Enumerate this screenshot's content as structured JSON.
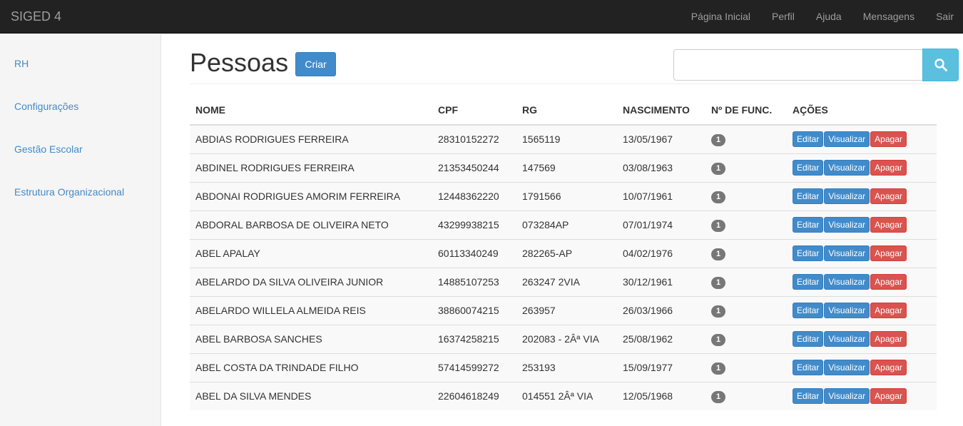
{
  "app": {
    "brand": "SIGED 4",
    "nav": [
      "Página Inicial",
      "Perfil",
      "Ajuda",
      "Mensagens",
      "Sair"
    ]
  },
  "sidebar": {
    "items": [
      "RH",
      "Configurações",
      "Gestão Escolar",
      "Estrutura Organizacional"
    ]
  },
  "page": {
    "title": "Pessoas",
    "create_label": "Criar",
    "search_value": ""
  },
  "table": {
    "headers": [
      "NOME",
      "CPF",
      "RG",
      "NASCIMENTO",
      "Nº DE FUNC.",
      "AÇÕES"
    ],
    "actions": {
      "edit": "Editar",
      "view": "Visualizar",
      "delete": "Apagar"
    },
    "rows": [
      {
        "nome": "ABDIAS RODRIGUES FERREIRA",
        "cpf": "28310152272",
        "rg": "1565119",
        "nascimento": "13/05/1967",
        "func": "1"
      },
      {
        "nome": "ABDINEL RODRIGUES FERREIRA",
        "cpf": "21353450244",
        "rg": "147569",
        "nascimento": "03/08/1963",
        "func": "1"
      },
      {
        "nome": "ABDONAI RODRIGUES AMORIM FERREIRA",
        "cpf": "12448362220",
        "rg": "1791566",
        "nascimento": "10/07/1961",
        "func": "1"
      },
      {
        "nome": "ABDORAL BARBOSA DE OLIVEIRA NETO",
        "cpf": "43299938215",
        "rg": "073284AP",
        "nascimento": "07/01/1974",
        "func": "1"
      },
      {
        "nome": "ABEL APALAY",
        "cpf": "60113340249",
        "rg": "282265-AP",
        "nascimento": "04/02/1976",
        "func": "1"
      },
      {
        "nome": "ABELARDO DA SILVA OLIVEIRA JUNIOR",
        "cpf": "14885107253",
        "rg": "263247 2VIA",
        "nascimento": "30/12/1961",
        "func": "1"
      },
      {
        "nome": "ABELARDO WILLELA ALMEIDA REIS",
        "cpf": "38860074215",
        "rg": "263957",
        "nascimento": "26/03/1966",
        "func": "1"
      },
      {
        "nome": "ABEL BARBOSA SANCHES",
        "cpf": "16374258215",
        "rg": "202083 - 2Âª VIA",
        "nascimento": "25/08/1962",
        "func": "1"
      },
      {
        "nome": "ABEL COSTA DA TRINDADE FILHO",
        "cpf": "57414599272",
        "rg": "253193",
        "nascimento": "15/09/1977",
        "func": "1"
      },
      {
        "nome": "ABEL DA SILVA MENDES",
        "cpf": "22604618249",
        "rg": "014551 2Âª VIA",
        "nascimento": "12/05/1968",
        "func": "1"
      }
    ]
  },
  "icons": {
    "search": "search-icon"
  },
  "colors": {
    "primary": "#428bca",
    "info": "#5bc0de",
    "danger": "#d9534f",
    "navbar": "#222222"
  }
}
